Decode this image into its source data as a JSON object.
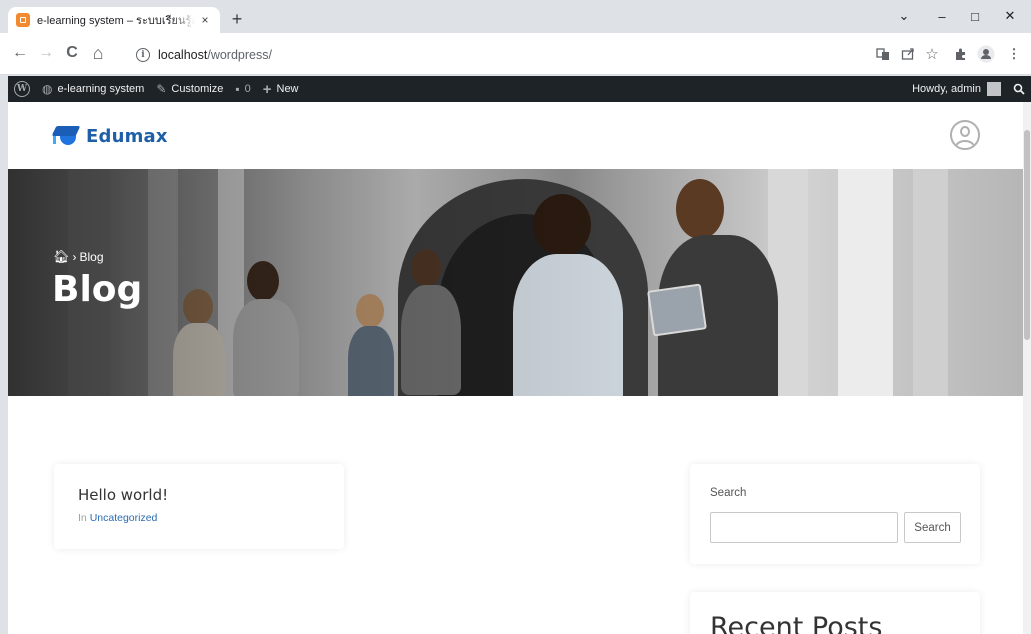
{
  "browser": {
    "tab_title": "e-learning system – ระบบเรียนรู้ออนไลน์",
    "tab_close": "×",
    "new_tab": "+",
    "window_controls": {
      "chevron": "⌄",
      "minimize": "–",
      "maximize": "□",
      "close": "✕"
    },
    "nav": {
      "back": "←",
      "forward": "→",
      "reload": "C",
      "home": "⌂"
    },
    "url_host": "localhost",
    "url_path": "/wordpress/",
    "toolbar_icons": [
      "translate-icon",
      "share-icon",
      "star-icon",
      "extensions-icon",
      "profile-icon",
      "menu-icon"
    ]
  },
  "adminbar": {
    "site_name": "e-learning system",
    "customize": "Customize",
    "comments_count": "0",
    "new": "New",
    "howdy": "Howdy, admin"
  },
  "site": {
    "logo_text": "Edumax"
  },
  "hero": {
    "breadcrumb": "Blog",
    "title": "Blog"
  },
  "post": {
    "title": "Hello world!",
    "meta_prefix": "In",
    "category": "Uncategorized"
  },
  "search_widget": {
    "label": "Search",
    "input_value": "",
    "button": "Search"
  },
  "recent_widget": {
    "title": "Recent Posts"
  },
  "colors": {
    "admin_bar": "#1d2327",
    "brand_blue": "#1e5fa8",
    "link": "#2b6cb0",
    "tab_favicon": "#f28b30"
  }
}
